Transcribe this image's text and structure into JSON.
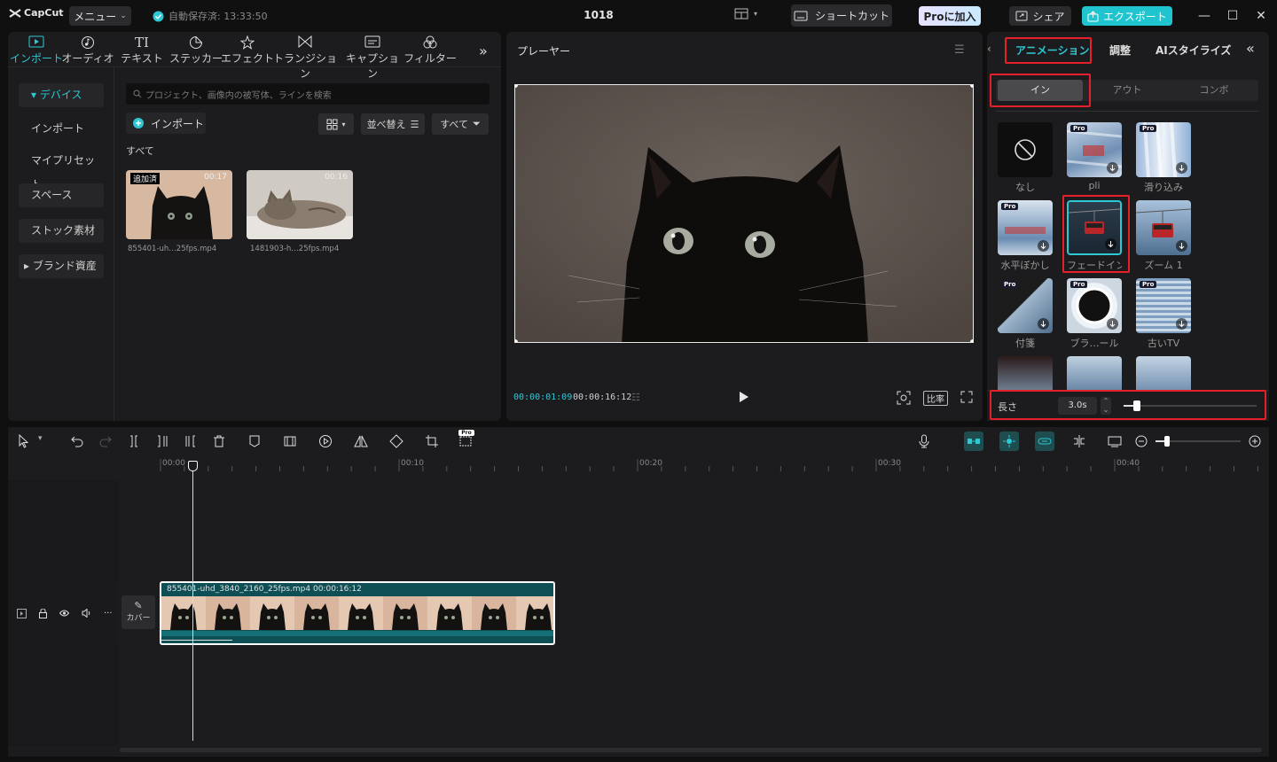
{
  "topbar": {
    "logo": "CapCut",
    "menu_label": "メニュー",
    "autosave": "自動保存済: 13:33:50",
    "project_title": "1018",
    "shortcut": "ショートカット",
    "pro": "Proに加入",
    "share": "シェア",
    "export": "エクスポート"
  },
  "media_tabs": [
    "インポート",
    "オーディオ",
    "テキスト",
    "ステッカー",
    "エフェクト",
    "トランジション",
    "キャプション",
    "フィルター"
  ],
  "sidebar": {
    "device": "デバイス",
    "import": "インポート",
    "presets": "マイプリセット",
    "space": "スペース",
    "stock": "ストック素材",
    "brand": "ブランド資産"
  },
  "library": {
    "search_placeholder": "プロジェクト、画像内の被写体、ラインを検索",
    "import_btn": "インポート",
    "sort": "並べ替え",
    "filter": "すべて",
    "all_label": "すべて",
    "items": [
      {
        "name": "855401-uh…25fps.mp4",
        "duration": "00:17",
        "badge": "追加済"
      },
      {
        "name": "1481903-h…25fps.mp4",
        "duration": "00:16",
        "badge": ""
      }
    ]
  },
  "player": {
    "title": "プレーヤー",
    "current_time": "00:00:01:09",
    "total_time": "00:00:16:12",
    "ratio": "比率"
  },
  "properties": {
    "tabs": [
      "アニメーション",
      "調整",
      "AIスタイライズ"
    ],
    "segments": [
      "イン",
      "アウト",
      "コンボ"
    ],
    "effects": [
      {
        "label": "なし",
        "pro": false
      },
      {
        "label": "pli",
        "pro": true
      },
      {
        "label": "滑り込み",
        "pro": true
      },
      {
        "label": "水平ぼかし",
        "pro": true
      },
      {
        "label": "フェードイン",
        "pro": false
      },
      {
        "label": "ズーム 1",
        "pro": false
      },
      {
        "label": "付箋",
        "pro": true
      },
      {
        "label": "ブラ…ール",
        "pro": true
      },
      {
        "label": "古いTV",
        "pro": true
      }
    ],
    "pro_tag": "Pro",
    "duration_label": "長さ",
    "duration_value": "3.0s",
    "duration_slider": 0.1
  },
  "timeline": {
    "ticks": [
      "00:00",
      "00:10",
      "00:20",
      "00:30",
      "00:40"
    ],
    "clip_label": "855401-uhd_3840_2160_25fps.mp4   00:00:16:12",
    "cover": "カバー"
  },
  "colors": {
    "accent": "#2ec7d4",
    "highlight": "#e5202a",
    "clip": "#0e4f55"
  }
}
